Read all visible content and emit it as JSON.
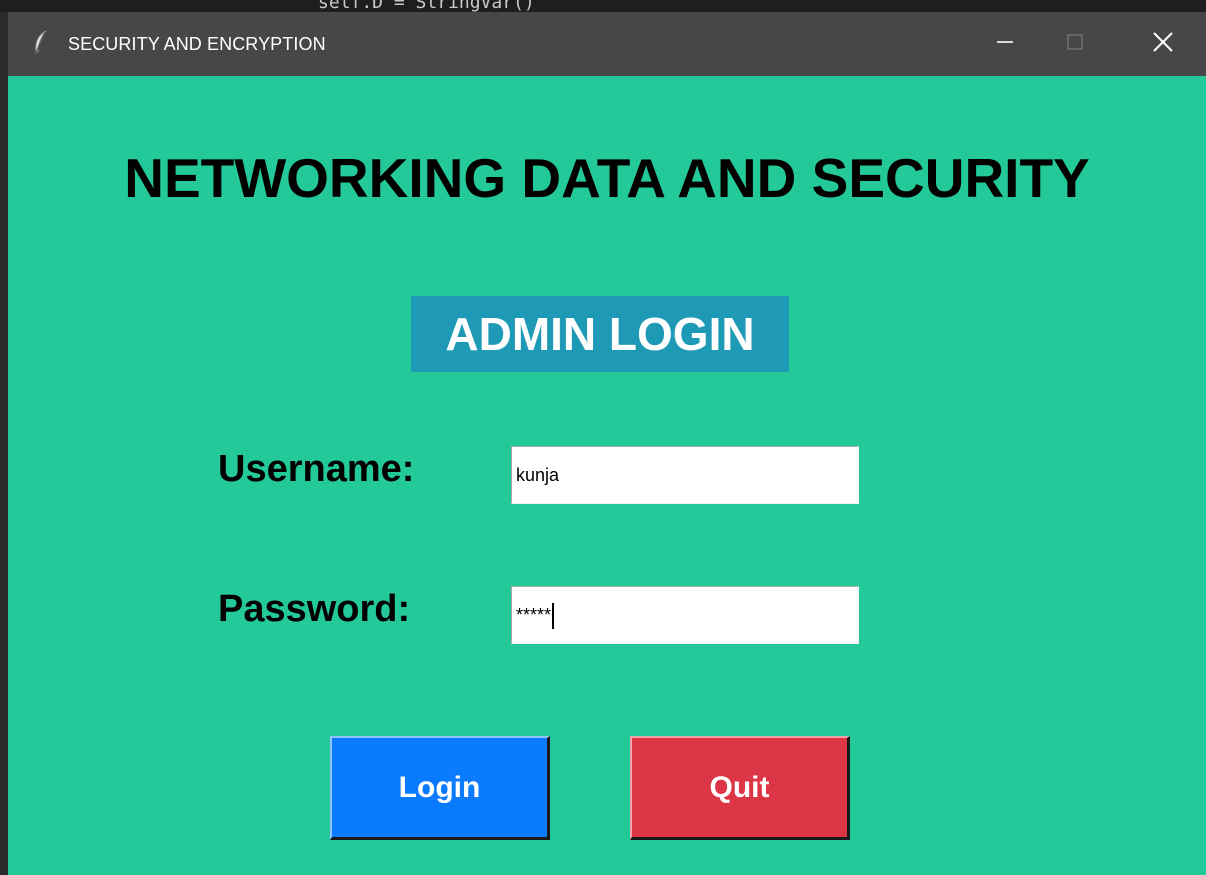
{
  "window": {
    "title": "SECURITY AND ENCRYPTION",
    "icon": "feather-icon",
    "controls": {
      "minimize": "minimize-icon",
      "maximize": "maximize-icon",
      "close": "close-icon"
    }
  },
  "background_code": "self.D = StringVar()",
  "main": {
    "heading": "NETWORKING DATA AND SECURITY",
    "subheading": "ADMIN LOGIN",
    "username": {
      "label": "Username:",
      "value": "kunja"
    },
    "password": {
      "label": "Password:",
      "value": "*****"
    },
    "buttons": {
      "login": "Login",
      "quit": "Quit"
    }
  },
  "colors": {
    "background": "#23c999",
    "titlebar": "#474747",
    "subheading_bg": "#1e9ab6",
    "login_button": "#0a7bff",
    "quit_button": "#dc3545"
  }
}
